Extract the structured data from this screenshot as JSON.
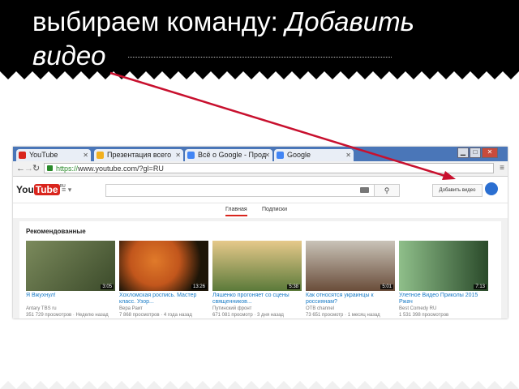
{
  "slide": {
    "title_plain": "выбираем команду: ",
    "title_italic": "Добавить",
    "title_line2": "видео"
  },
  "browser": {
    "tabs": [
      {
        "label": "YouTube",
        "color": "#d9251d"
      },
      {
        "label": "Презентация всего",
        "color": "#f2b01e"
      },
      {
        "label": "Всё о Google - Прод",
        "color": "#4285f4"
      },
      {
        "label": "Google",
        "color": "#4285f4"
      }
    ],
    "url_https": "https://",
    "url_rest": "www.youtube.com/?gl=RU",
    "back_icon": "arrow-left-icon",
    "forward_icon": "arrow-right-icon",
    "reload_icon": "reload-icon"
  },
  "youtube": {
    "logo_you": "You",
    "logo_tube": "Tube",
    "logo_ru": "RU",
    "search_placeholder": "",
    "search_button_glyph": "⚲",
    "add_video_label": "Добавить видео",
    "tabs": [
      "Главная",
      "Подписки"
    ],
    "section_title": "Рекомендованные",
    "videos": [
      {
        "title": "Я Вжухнул!",
        "meta1": "Antary TBS ru",
        "meta2": "351 729 просмотров · Неделю назад",
        "duration": "3:05",
        "colors": [
          "#7b8a5c",
          "#3b4a2a"
        ]
      },
      {
        "title": "Хохломская роспись. Мастер класс. Узор...",
        "meta1": "Вера Раит",
        "meta2": "7 868 просмотров · 4 года назад",
        "duration": "13:26",
        "colors": [
          "#c2561c",
          "#1d1508"
        ]
      },
      {
        "title": "Ляшенко прогоняет со сцены священников...",
        "meta1": "Путинский фронт",
        "meta2": "671 081 просмотр · 3 дня назад",
        "duration": "5:38",
        "colors": [
          "#e6c98a",
          "#5b7a3a"
        ]
      },
      {
        "title": "Как относятся украинцы к россиянам?",
        "meta1": "ОТВ channel",
        "meta2": "73 651 просмотр · 1 месяц назад",
        "duration": "5:01",
        "colors": [
          "#c9c3b8",
          "#6a4d3a"
        ]
      },
      {
        "title": "Улетное Видео Приколы 2015 Ржач",
        "meta1": "Best Comedy RU",
        "meta2": "1 531 398 просмотров",
        "duration": "7:13",
        "colors": [
          "#8fbf8a",
          "#2a4a2a"
        ]
      }
    ]
  },
  "colors": {
    "arrow": "#c8102e",
    "youtube_red": "#d9251d",
    "tabbar_blue": "#4a76b8"
  }
}
